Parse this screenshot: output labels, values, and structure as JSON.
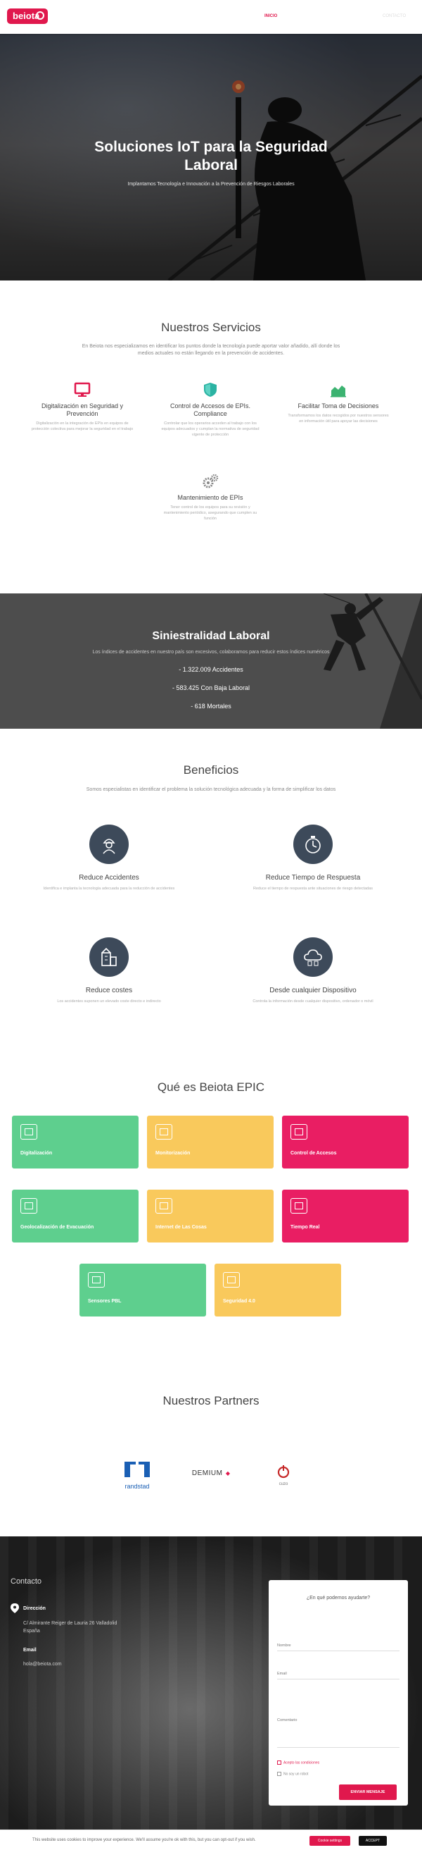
{
  "header": {
    "logo_text": "beiota",
    "nav_active": "INICIO",
    "nav_right": "CONTACTO"
  },
  "hero": {
    "title": "Soluciones IoT para la Seguridad Laboral",
    "subtitle": "Implantamos Tecnología e Innovación a la Prevención de Riesgos Laborales"
  },
  "services": {
    "title": "Nuestros Servicios",
    "intro": "En Beiota nos especializamos en identificar los puntos donde la tecnología puede aportar valor añadido, allí donde los medios actuales no están llegando en la prevención de accidentes.",
    "items": [
      {
        "title": "Digitalización en Seguridad y Prevención",
        "desc": "Digitalización en la integración de EPIs en equipos de protección colectiva para mejorar la seguridad en el trabajo",
        "icon": "monitor-icon",
        "color": "#e0184d"
      },
      {
        "title": "Control de Accesos de EPIs. Compliance",
        "desc": "Controlar que los operarios acceden al trabajo con los equipos adecuados y cumplan la normativa de seguridad vigente de protección",
        "icon": "shield-icon",
        "color": "#2bb3a3"
      },
      {
        "title": "Facilitar Toma de Decisiones",
        "desc": "Transformamos los datos recogidos por nuestros sensores en información útil para apoyar las decisiones",
        "icon": "chart-icon",
        "color": "#3cb371"
      },
      {
        "title": "Mantenimiento de EPIs",
        "desc": "Tener control de los equipos para su revisión y mantenimiento periódico, asegurando que cumplen su función",
        "icon": "gears-icon",
        "color": "#888888"
      }
    ]
  },
  "siniestralidad": {
    "title": "Siniestralidad Laboral",
    "intro": "Los índices de accidentes en nuestro país son excesivos, colaboramos para reducir estos índices numéricos",
    "stats": [
      "- 1.322.009 Accidentes",
      "- 583.425 Con Baja Laboral",
      "- 618 Mortales"
    ]
  },
  "benefits": {
    "title": "Beneficios",
    "intro": "Somos especialistas en identificar el problema la solución tecnológica adecuada y la forma de simplificar los datos",
    "items": [
      {
        "title": "Reduce Accidentes",
        "desc": "Identifica e implanta la tecnología adecuada para la reducción de accidentes",
        "icon": "worker-icon"
      },
      {
        "title": "Reduce Tiempo de Respuesta",
        "desc": "Reduce el tiempo de respuesta ante situaciones de riesgo detectadas",
        "icon": "stopwatch-icon"
      },
      {
        "title": "Reduce costes",
        "desc": "Los accidentes suponen un elevado coste directo e indirecto",
        "icon": "building-icon"
      },
      {
        "title": "Desde cualquier Dispositivo",
        "desc": "Controla la información desde cualquier dispositivo, ordenador o móvil",
        "icon": "cloud-icon"
      }
    ]
  },
  "epic": {
    "title": "Qué es Beiota EPIC",
    "cards": [
      {
        "label": "Digitalización",
        "color": "green",
        "icon": "qr-icon"
      },
      {
        "label": "Monitorización",
        "color": "yellow",
        "icon": "monitor-icon"
      },
      {
        "label": "Control de Accesos",
        "color": "pink",
        "icon": "helmet-icon"
      },
      {
        "label": "Geolocalización de Evacuación",
        "color": "green",
        "icon": "location-icon"
      },
      {
        "label": "Internet de Las Cosas",
        "color": "yellow",
        "icon": "iot-icon"
      },
      {
        "label": "Tiempo Real",
        "color": "pink",
        "icon": "clock-icon"
      },
      {
        "label": "Sensores PBL",
        "color": "green",
        "icon": "sensor-icon"
      },
      {
        "label": "Seguridad 4.0",
        "color": "yellow",
        "icon": "worker-icon"
      }
    ]
  },
  "partners": {
    "title": "Nuestros Partners",
    "items": [
      {
        "name": "randstad"
      },
      {
        "name": "DEMIUM"
      },
      {
        "name": "cuzo"
      }
    ]
  },
  "footer": {
    "contact_title": "Contacto",
    "address_label": "Dirección",
    "address_lines": [
      "C/ Almirante Reiger de Lauria 26 Valladolid",
      "España"
    ],
    "email_label": "Email",
    "email_value": "hola@beiota.com",
    "form_title": "¿En qué podemos ayudarte?",
    "name_placeholder": "Nombre",
    "email_placeholder": "Email",
    "message_placeholder": "Comentario",
    "terms_label": "Acepto las condiciones",
    "robot_label": "No soy un robot",
    "send_label": "ENVIAR MENSAJE"
  },
  "cookie": {
    "text": "This website uses cookies to improve your experience. We'll assume you're ok with this, but you can opt-out if you wish.",
    "settings_label": "Cookie settings",
    "accept_label": "ACCEPT"
  }
}
